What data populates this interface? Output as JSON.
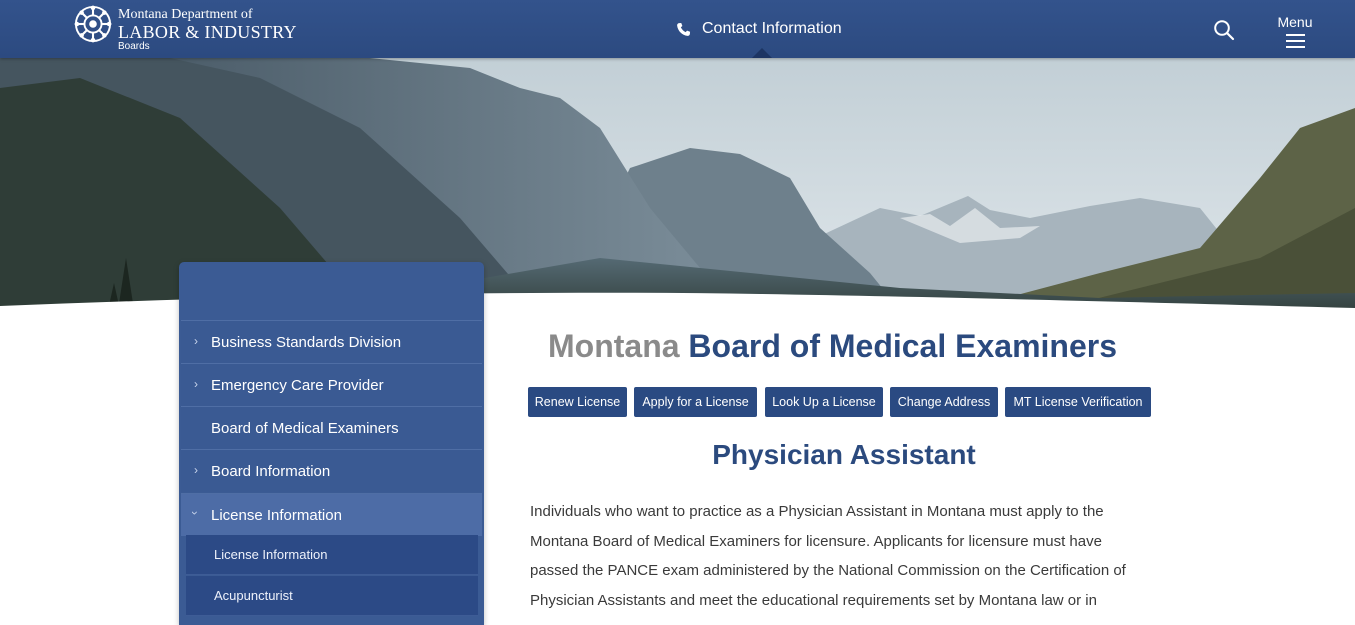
{
  "header": {
    "logo_line1": "Montana Department of",
    "logo_line2": "LABOR & INDUSTRY",
    "logo_line3": "Boards",
    "contact_label": "Contact Information",
    "menu_label": "Menu"
  },
  "sidebar": {
    "items": [
      {
        "label": "Business Standards Division",
        "has_chevron": true
      },
      {
        "label": "Emergency Care Provider",
        "has_chevron": true
      },
      {
        "label": "Board of Medical Examiners",
        "has_chevron": false
      },
      {
        "label": "Board Information",
        "has_chevron": true
      },
      {
        "label": "License Information",
        "has_chevron": true,
        "expanded": true
      }
    ],
    "sub_items": [
      {
        "label": "License Information"
      },
      {
        "label": "Acupuncturist"
      }
    ]
  },
  "main": {
    "title_prefix": "Montana",
    "title_main": "Board of Medical Examiners",
    "buttons": [
      {
        "label": "Renew License"
      },
      {
        "label": "Apply for a License"
      },
      {
        "label": "Look Up a License"
      },
      {
        "label": "Change Address"
      },
      {
        "label": "MT License Verification"
      }
    ],
    "subheading": "Physician Assistant",
    "paragraph": "Individuals who want to practice as a Physician Assistant in Montana must apply to the Montana Board of Medical Examiners for licensure. Applicants for licensure must have passed the PANCE exam administered by the National Commission on the Certification of Physician Assistants and meet the educational requirements set by Montana law or in"
  },
  "colors": {
    "header_blue": "#2f4f88",
    "sidebar_blue": "#3b5b94",
    "button_blue": "#2a4a82",
    "title_blue": "#2b4a7e"
  }
}
